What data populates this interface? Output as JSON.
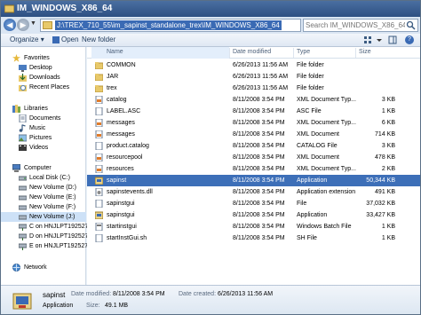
{
  "window": {
    "title": "IM_WINDOWS_X86_64"
  },
  "address": {
    "path": "J:\\TREX_710_55\\im_sapinst_standalone_trex\\IM_WINDOWS_X86_64",
    "search_placeholder": "Search IM_WINDOWS_X86_64"
  },
  "toolbar": {
    "organize": "Organize",
    "open": "Open",
    "new_folder": "New folder"
  },
  "nav": {
    "items": [
      {
        "label": "Favorites",
        "icon": "star-icon"
      },
      {
        "label": "Desktop",
        "icon": "desktop-icon"
      },
      {
        "label": "Downloads",
        "icon": "downloads-icon"
      },
      {
        "label": "Recent Places",
        "icon": "recent-places-icon"
      },
      {
        "label": "Libraries",
        "icon": "libraries-icon"
      },
      {
        "label": "Documents",
        "icon": "documents-icon"
      },
      {
        "label": "Music",
        "icon": "music-icon"
      },
      {
        "label": "Pictures",
        "icon": "pictures-icon"
      },
      {
        "label": "Videos",
        "icon": "videos-icon"
      },
      {
        "label": "Computer",
        "icon": "computer-icon"
      },
      {
        "label": "Local Disk (C:)",
        "icon": "drive-icon"
      },
      {
        "label": "New Volume (D:)",
        "icon": "drive-icon"
      },
      {
        "label": "New Volume (E:)",
        "icon": "drive-icon"
      },
      {
        "label": "New Volume (F:)",
        "icon": "drive-icon"
      },
      {
        "label": "New Volume (J:)",
        "icon": "drive-icon"
      },
      {
        "label": "C on HNJLPT192527",
        "icon": "network-drive-icon"
      },
      {
        "label": "D on HNJLPT192527",
        "icon": "network-drive-icon"
      },
      {
        "label": "E on HNJLPT192527",
        "icon": "network-drive-icon"
      },
      {
        "label": "Network",
        "icon": "network-icon"
      }
    ]
  },
  "columns": {
    "name": "Name",
    "date": "Date modified",
    "type": "Type",
    "size": "Size"
  },
  "files": [
    {
      "name": "COMMON",
      "date": "6/26/2013 11:56 AM",
      "type": "File folder",
      "size": "",
      "icon": "folder-icon"
    },
    {
      "name": "JAR",
      "date": "6/26/2013 11:56 AM",
      "type": "File folder",
      "size": "",
      "icon": "folder-icon"
    },
    {
      "name": "trex",
      "date": "6/26/2013 11:56 AM",
      "type": "File folder",
      "size": "",
      "icon": "folder-icon"
    },
    {
      "name": "catalog",
      "date": "8/11/2008 3:54 PM",
      "type": "XML Document Typ...",
      "size": "3 KB",
      "icon": "xml-file-icon"
    },
    {
      "name": "LABEL.ASC",
      "date": "8/11/2008 3:54 PM",
      "type": "ASC File",
      "size": "1 KB",
      "icon": "file-icon"
    },
    {
      "name": "messages",
      "date": "8/11/2008 3:54 PM",
      "type": "XML Document Typ...",
      "size": "6 KB",
      "icon": "xml-file-icon"
    },
    {
      "name": "messages",
      "date": "8/11/2008 3:54 PM",
      "type": "XML Document",
      "size": "714 KB",
      "icon": "xml-file-icon"
    },
    {
      "name": "product.catalog",
      "date": "8/11/2008 3:54 PM",
      "type": "CATALOG File",
      "size": "3 KB",
      "icon": "file-icon"
    },
    {
      "name": "resourcepool",
      "date": "8/11/2008 3:54 PM",
      "type": "XML Document",
      "size": "478 KB",
      "icon": "xml-file-icon"
    },
    {
      "name": "resources",
      "date": "8/11/2008 3:54 PM",
      "type": "XML Document Typ...",
      "size": "2 KB",
      "icon": "xml-file-icon"
    },
    {
      "name": "sapinst",
      "date": "8/11/2008 3:54 PM",
      "type": "Application",
      "size": "50,344 KB",
      "icon": "sapinst-app-icon"
    },
    {
      "name": "sapinstevents.dll",
      "date": "8/11/2008 3:54 PM",
      "type": "Application extension",
      "size": "491 KB",
      "icon": "dll-icon"
    },
    {
      "name": "sapinstgui",
      "date": "8/11/2008 3:54 PM",
      "type": "File",
      "size": "37,032 KB",
      "icon": "file-icon"
    },
    {
      "name": "sapinstgui",
      "date": "8/11/2008 3:54 PM",
      "type": "Application",
      "size": "33,427 KB",
      "icon": "sapinstgui-app-icon"
    },
    {
      "name": "startinstgui",
      "date": "8/11/2008 3:54 PM",
      "type": "Windows Batch File",
      "size": "1 KB",
      "icon": "batch-file-icon"
    },
    {
      "name": "startInstGui.sh",
      "date": "8/11/2008 3:54 PM",
      "type": "SH File",
      "size": "1 KB",
      "icon": "file-icon"
    }
  ],
  "selected_file": "sapinst",
  "status": {
    "name": "sapinst",
    "kind": "Application",
    "date_modified_label": "Date modified:",
    "date_modified": "8/11/2008 3:54 PM",
    "date_created_label": "Date created:",
    "date_created": "6/26/2013 11:56 AM",
    "size_label": "Size:",
    "size": "49.1 MB"
  },
  "colors": {
    "selection": "#3d6fb8",
    "title_bar": "#2d4f82",
    "folder": "#e8c96a"
  }
}
